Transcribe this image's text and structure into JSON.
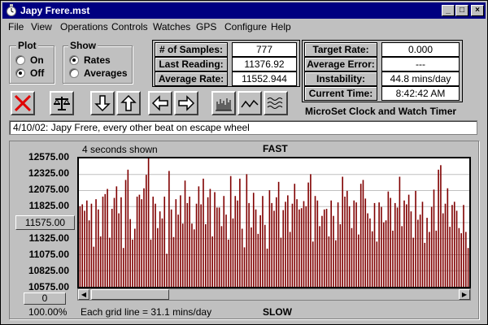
{
  "window": {
    "title": "Japy Frere.mst",
    "controls": [
      "_",
      "□",
      "×"
    ]
  },
  "menu": [
    "File",
    "View",
    "Operations",
    "Controls",
    "Watches",
    "GPS",
    "Configure",
    "Help"
  ],
  "plot_group": {
    "label": "Plot",
    "options": [
      {
        "label": "On",
        "selected": false
      },
      {
        "label": "Off",
        "selected": true
      }
    ]
  },
  "show_group": {
    "label": "Show",
    "options": [
      {
        "label": "Rates",
        "selected": true
      },
      {
        "label": "Averages",
        "selected": false
      }
    ]
  },
  "stats": {
    "samples_label": "# of Samples:",
    "samples_value": "777",
    "last_reading_label": "Last Reading:",
    "last_reading_value": "11376.92",
    "average_rate_label": "Average Rate:",
    "average_rate_value": "11552.944",
    "target_rate_label": "Target Rate:",
    "target_rate_value": "0.000",
    "average_error_label": "Average Error:",
    "average_error_value": "---",
    "instability_label": "Instability:",
    "instability_value": "44.8 mins/day",
    "current_time_label": "Current Time:",
    "current_time_value": "8:42:42 AM"
  },
  "toolbar": {
    "icons": [
      "stop-icon",
      "balance-icon",
      "down-arrow-icon",
      "up-arrow-icon",
      "left-arrow-icon",
      "right-arrow-icon",
      "bar-graph-icon",
      "line-graph-icon",
      "wave-graph-icon"
    ]
  },
  "app_caption": "MicroSet Clock and Watch Timer",
  "comment": "4/10/02: Japy Frere, every other beat on escape wheel",
  "plot": {
    "seconds_shown": "4 seconds shown",
    "fast_label": "FAST",
    "slow_label": "SLOW",
    "grid_note": "Each grid line = 31.1 mins/day",
    "center_button": "11575.00",
    "offset_button": "0",
    "zoom": "100.00%",
    "y_ticks": [
      "12575.00",
      "12325.00",
      "12075.00",
      "11825.00",
      "11325.00",
      "11075.00",
      "10825.00",
      "10575.00"
    ],
    "bar_color": "#800000"
  },
  "chart_data": {
    "type": "bar",
    "ylim": [
      10575,
      12575
    ],
    "values": [
      11830,
      11860,
      11760,
      11920,
      11610,
      11870,
      11200,
      11940,
      11780,
      11360,
      11980,
      12020,
      12100,
      11340,
      11790,
      11960,
      12140,
      11720,
      11970,
      11180,
      12240,
      12400,
      11630,
      11310,
      11480,
      11980,
      12010,
      11940,
      12110,
      12320,
      12590,
      11310,
      11980,
      11870,
      11490,
      11750,
      11640,
      11980,
      11090,
      12380,
      11780,
      11350,
      11940,
      11700,
      12000,
      11560,
      12230,
      11880,
      11980,
      11560,
      11470,
      11870,
      12140,
      11860,
      12260,
      11550,
      11970,
      12100,
      11360,
      12050,
      11810,
      11810,
      11520,
      11990,
      11700,
      11310,
      12300,
      11640,
      11990,
      11920,
      12260,
      11480,
      11190,
      12330,
      11880,
      11500,
      12040,
      11780,
      11400,
      11690,
      11990,
      11540,
      11170,
      12080,
      11880,
      11760,
      11970,
      12210,
      11340,
      11770,
      11900,
      12000,
      11430,
      11870,
      12180,
      11940,
      11780,
      11800,
      11910,
      11830,
      12200,
      12330,
      11280,
      11990,
      11920,
      11520,
      11680,
      11780,
      11790,
      11360,
      11920,
      11680,
      11300,
      11890,
      11550,
      12290,
      11980,
      12070,
      11830,
      11490,
      11920,
      11890,
      11390,
      12180,
      12240,
      11950,
      11720,
      11640,
      11440,
      11880,
      11280,
      11890,
      11820,
      11580,
      11610,
      12060,
      11960,
      11450,
      11880,
      11810,
      12290,
      11520,
      11920,
      11860,
      12010,
      11750,
      11340,
      12070,
      11620,
      11700,
      11900,
      11260,
      11650,
      11430,
      11820,
      12090,
      11450,
      12400,
      12470,
      11720,
      11870,
      12110,
      11510,
      11850,
      11900,
      11760,
      11490,
      11410,
      11850,
      11430,
      11180
    ]
  }
}
